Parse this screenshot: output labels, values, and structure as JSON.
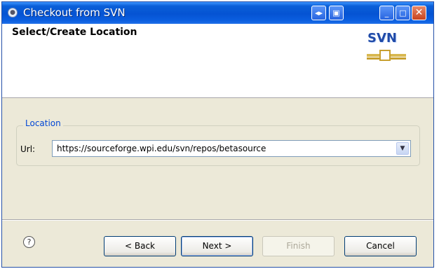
{
  "window": {
    "title": "Checkout from SVN",
    "titlebar_buttons": [
      "restore-icon",
      "maximize-icon",
      "minimize-icon",
      "maximize-window-icon",
      "close-icon"
    ]
  },
  "header": {
    "title": "Select/Create Location",
    "logo_text": "SVN"
  },
  "location_group": {
    "legend": "Location",
    "url_label": "Url:",
    "url_value": "https://sourceforge.wpi.edu/svn/repos/betasource"
  },
  "footer": {
    "back_label": "< Back",
    "next_label": "Next >",
    "finish_label": "Finish",
    "cancel_label": "Cancel"
  },
  "colors": {
    "titlebar": "#0553d3",
    "dialog_bg": "#ece9d8",
    "legend": "#0046d5",
    "disabled_text": "#aca899"
  }
}
